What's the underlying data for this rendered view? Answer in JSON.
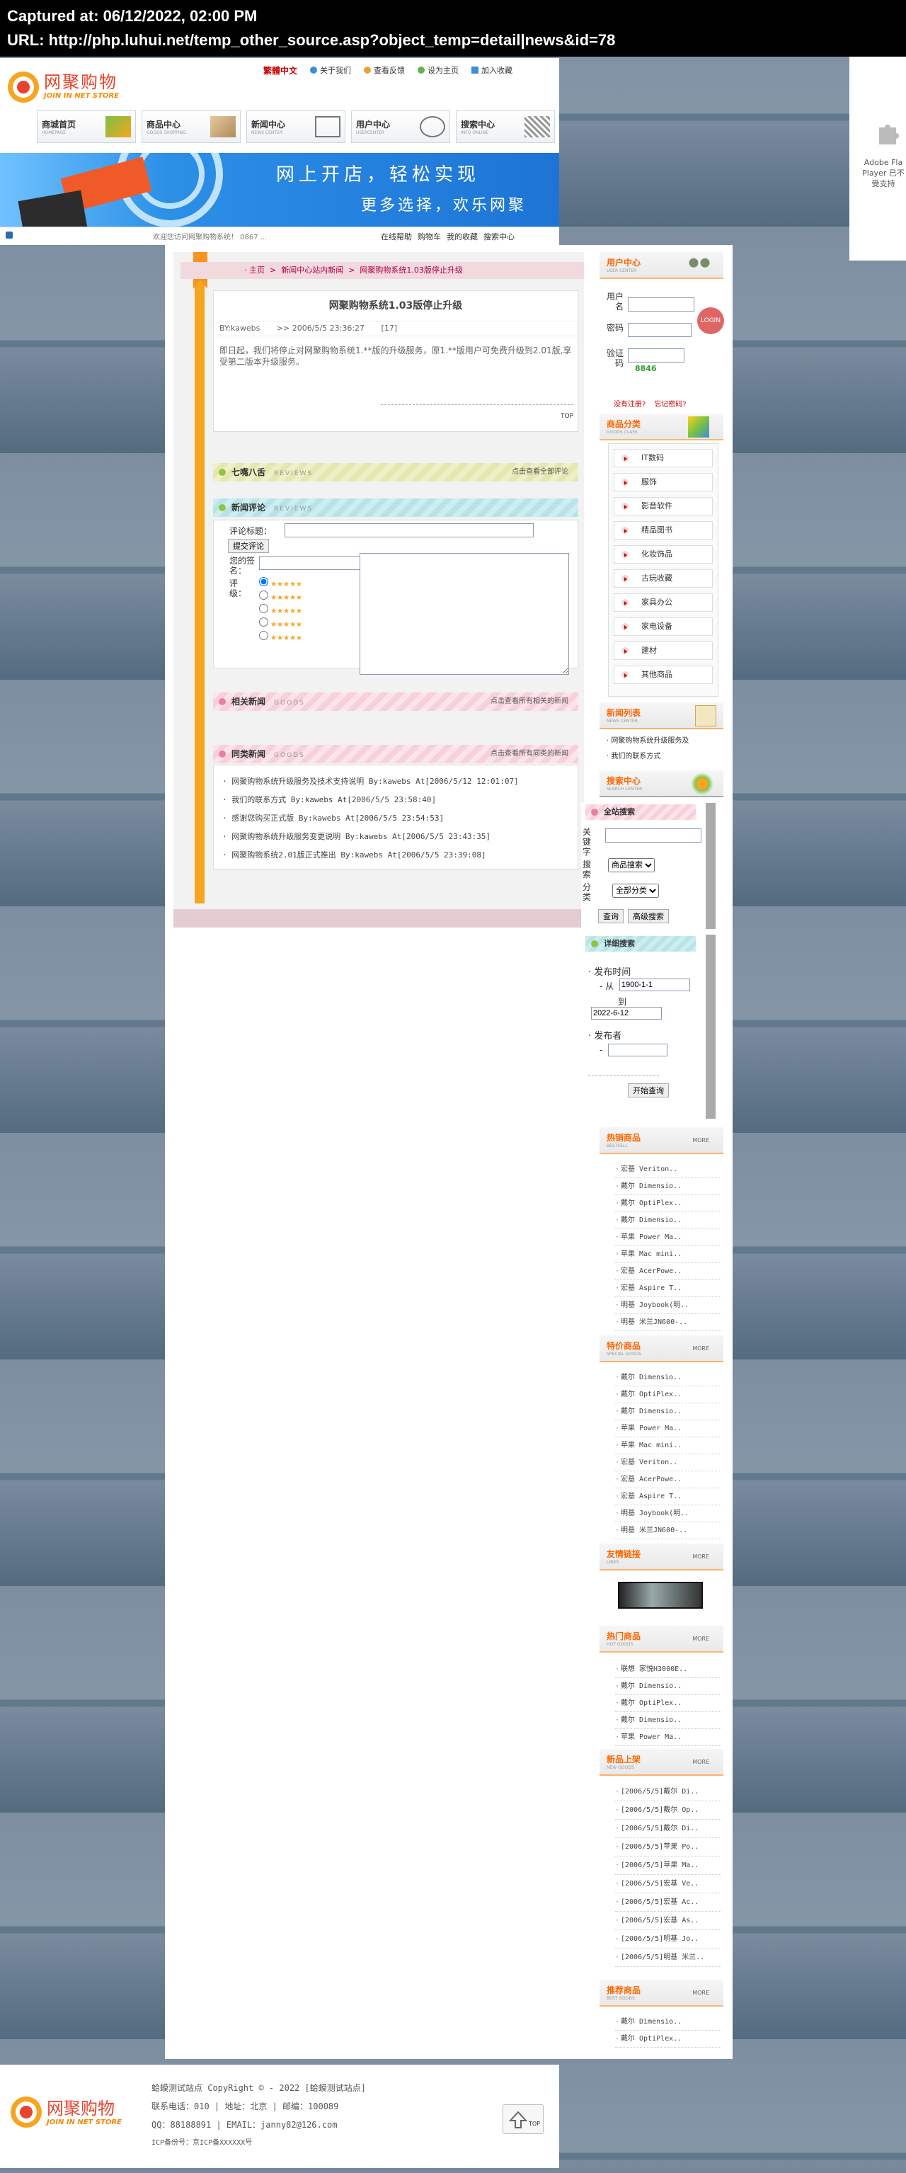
{
  "capture": {
    "time": "Captured at: 06/12/2022, 02:00 PM",
    "url": "URL: http://php.luhui.net/temp_other_source.asp?object_temp=detail|news&id=78"
  },
  "header": {
    "logo_cn": "网聚购物",
    "logo_en": "JOIN IN NET STORE",
    "lang": "繁體中文",
    "toplinks": [
      "关于我们",
      "查看反馈",
      "设为主页",
      "加入收藏"
    ],
    "nav": [
      {
        "cn": "商城首页",
        "en": "HOMEPAGE"
      },
      {
        "cn": "商品中心",
        "en": "GOODS SHOPPING"
      },
      {
        "cn": "新闻中心",
        "en": "NEWS CENTER"
      },
      {
        "cn": "用户中心",
        "en": "USERCENTER"
      },
      {
        "cn": "搜索中心",
        "en": "INFO ONLINE"
      }
    ],
    "banner_t1": "网上开店，轻松实现",
    "banner_t2": "更多选择，欢乐网聚",
    "marquee": "欢迎您访问网聚购物系统！ 0867 ...",
    "statlinks": [
      "在线帮助",
      "购物车",
      "我的收藏",
      "搜索中心"
    ]
  },
  "flash": {
    "line1": "Adobe Fla",
    "line2": "Player 已不",
    "line3": "受支持"
  },
  "breadcrumb": [
    "主页",
    "新闻中心站内新闻",
    "网聚购物系统1.03版停止升级"
  ],
  "article": {
    "title": "网聚购物系统1.03版停止升级",
    "author": "BY:kawebs",
    "date": ">> 2006/5/5 23:36:27",
    "hits": "[17]",
    "body": "即日起，我们将停止对网聚购物系统1.**版的升级服务，原1.**版用户可免费升级到2.01版,享受第二版本升级服务。",
    "top": "TOP"
  },
  "comments": {
    "title": "七嘴八舌",
    "en": "REVIEWS",
    "more": "点击查看全部评论"
  },
  "review": {
    "title": "新闻评论",
    "en": "REVIEWS",
    "label_subject": "评论标题：",
    "submit": "提交评论",
    "label_name": "您的签名：",
    "label_rating": "评级："
  },
  "related": {
    "title": "相关新闻",
    "en": "GOODS",
    "more": "点击查看所有相关的新闻"
  },
  "similar": {
    "title": "同类新闻",
    "en": "GOODS",
    "more": "点击查看所有同类的新闻",
    "items": [
      "网聚购物系统升级服务及技术支持说明 By:kawebs At[2006/5/12 12:01:07]",
      "我们的联系方式 By:kawebs At[2006/5/5 23:58:40]",
      "感谢您购买正式版 By:kawebs At[2006/5/5 23:54:53]",
      "网聚购物系统升级服务变更说明 By:kawebs At[2006/5/5 23:43:35]",
      "网聚购物系统2.01版正式推出 By:kawebs At[2006/5/5 23:39:08]"
    ]
  },
  "user": {
    "title": "用户中心",
    "en": "USER CENTER",
    "label_user": "用户名",
    "label_pass": "密码",
    "label_code": "验证码",
    "code": "8846",
    "login": "LOGIN",
    "reg": "没有注册?",
    "forgot": "忘记密码?"
  },
  "cats": {
    "title": "商品分类",
    "en": "GOODS CLASS",
    "items": [
      "IT数码",
      "服饰",
      "影音软件",
      "精品图书",
      "化妆饰品",
      "古玩收藏",
      "家具办公",
      "家电设备",
      "建材",
      "其他商品"
    ]
  },
  "news": {
    "title": "新闻列表",
    "en": "NEWS CENTER",
    "items": [
      "网聚购物系统升级服务及",
      "我们的联系方式"
    ]
  },
  "search": {
    "title": "搜索中心",
    "en": "SEARCH CENTER",
    "sub": "全站搜索",
    "label_kw": "关键字",
    "label_type": "搜索",
    "label_class": "分类",
    "sel1": "商品搜索",
    "sel2": "全部分类",
    "btn1": "查询",
    "btn2": "高级搜索"
  },
  "adv": {
    "title": "详细搜索",
    "label_time": "发布时间",
    "from": "从",
    "from_val": "1900-1-1",
    "to": "到",
    "to_val": "2022-6-12",
    "label_pub": "发布者",
    "btn": "开始查询"
  },
  "hot": {
    "title": "热销商品",
    "en": "BESTSELL",
    "more": "MORE",
    "items": [
      "宏基 Veriton..",
      "戴尔 Dimensio..",
      "戴尔 OptiPlex..",
      "戴尔 Dimensio..",
      "苹果 Power Ma..",
      "苹果 Mac mini..",
      "宏基 AcerPowe..",
      "宏基 Aspire T..",
      "明基 Joybook(明..",
      "明基 米兰JN600-.."
    ]
  },
  "special": {
    "title": "特价商品",
    "en": "SPECIAL GOODS",
    "more": "MORE",
    "items": [
      "戴尔 Dimensio..",
      "戴尔 OptiPlex..",
      "戴尔 Dimensio..",
      "苹果 Power Ma..",
      "苹果 Mac mini..",
      "宏基 Veriton..",
      "宏基 AcerPowe..",
      "宏基 Aspire T..",
      "明基 Joybook(明..",
      "明基 米兰JN600-.."
    ]
  },
  "links": {
    "title": "友情链接",
    "en": "LINKS",
    "more": "MORE"
  },
  "hotgoods": {
    "title": "热门商品",
    "en": "HOT GOODS",
    "more": "MORE",
    "items": [
      "联想 家悦H3000E..",
      "戴尔 Dimensio..",
      "戴尔 OptiPlex..",
      "戴尔 Dimensio..",
      "苹果 Power Ma.."
    ]
  },
  "newgoods": {
    "title": "新品上架",
    "en": "NEW GOODS",
    "more": "MORE",
    "items": [
      "[2006/5/5]戴尔 Di..",
      "[2006/5/5]戴尔 Op..",
      "[2006/5/5]戴尔 Di..",
      "[2006/5/5]苹果 Po..",
      "[2006/5/5]苹果 Ma..",
      "[2006/5/5]宏基 Ve..",
      "[2006/5/5]宏基 Ac..",
      "[2006/5/5]宏基 As..",
      "[2006/5/5]明基 Jo..",
      "[2006/5/5]明基 米兰.."
    ]
  },
  "recommend": {
    "title": "推荐商品",
    "en": "BEST GOODS",
    "more": "MORE",
    "items": [
      "戴尔 Dimensio..",
      "戴尔 OptiPlex.."
    ]
  },
  "footer": {
    "line1": "蛤蟆测试站点 CopyRight © - 2022 [蛤蟆测试站点]",
    "line2": "联系电话：010 | 地址：北京 | 邮编：100089",
    "line3": "QQ：88188891 | EMAIL：janny82@126.com",
    "line4": "ICP备份号：京ICP备XXXXXX号",
    "top": "TOP"
  }
}
